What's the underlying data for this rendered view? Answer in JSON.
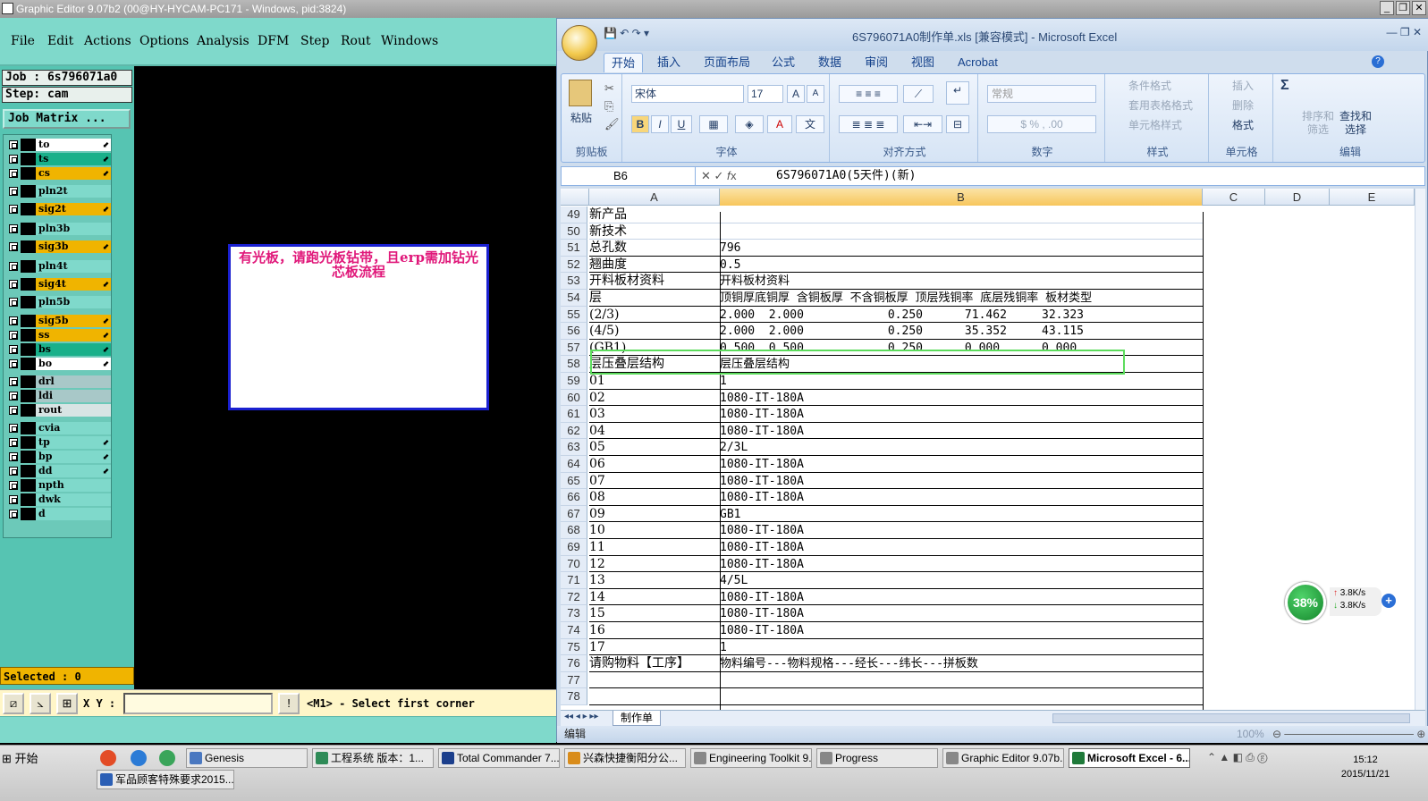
{
  "ge": {
    "title": "Graphic Editor 9.07b2 (00@HY-HYCAM-PC171 - Windows, pid:3824)",
    "menu": [
      "File",
      "Edit",
      "Actions",
      "Options",
      "Analysis",
      "DFM",
      "Step",
      "Rout",
      "Windows"
    ],
    "job_label": "Job : 6s796071a0",
    "step_label": "Step: cam",
    "job_matrix": "Job Matrix ...",
    "layers": [
      {
        "name": "to",
        "color": "#ffffff",
        "arrow": true
      },
      {
        "name": "ts",
        "color": "#19b08a",
        "arrow": true
      },
      {
        "name": "cs",
        "color": "#f0b400",
        "arrow": true
      },
      {
        "name": "pln2t",
        "color": "#7fd9cb",
        "arrow": false
      },
      {
        "name": "sig2t",
        "color": "#f0b400",
        "arrow": true
      },
      {
        "name": "pln3b",
        "color": "#7fd9cb",
        "arrow": false
      },
      {
        "name": "sig3b",
        "color": "#f0b400",
        "arrow": true
      },
      {
        "name": "pln4t",
        "color": "#7fd9cb",
        "arrow": false
      },
      {
        "name": "sig4t",
        "color": "#f0b400",
        "arrow": true
      },
      {
        "name": "pln5b",
        "color": "#7fd9cb",
        "arrow": false
      },
      {
        "name": "sig5b",
        "color": "#f0b400",
        "arrow": true
      },
      {
        "name": "ss",
        "color": "#f0b400",
        "arrow": true
      },
      {
        "name": "bs",
        "color": "#19b08a",
        "arrow": true
      },
      {
        "name": "bo",
        "color": "#ffffff",
        "arrow": true
      },
      {
        "name": "drl",
        "color": "#a8c8c8",
        "arrow": false
      },
      {
        "name": "ldi",
        "color": "#a8c8c8",
        "arrow": false
      },
      {
        "name": "rout",
        "color": "#d8e4e4",
        "arrow": false
      },
      {
        "name": "cvia",
        "color": "#7fd9cb",
        "arrow": false
      },
      {
        "name": "tp",
        "color": "#7fd9cb",
        "arrow": true
      },
      {
        "name": "bp",
        "color": "#7fd9cb",
        "arrow": true
      },
      {
        "name": "dd",
        "color": "#7fd9cb",
        "arrow": true
      },
      {
        "name": "npth",
        "color": "#7fd9cb",
        "arrow": false
      },
      {
        "name": "dwk",
        "color": "#7fd9cb",
        "arrow": false
      },
      {
        "name": "d",
        "color": "#7fd9cb",
        "arrow": false
      }
    ],
    "selected": "Selected : 0",
    "note": "有光板，请跑光板钻带，且erp需加钻光芯板流程",
    "xy_label": "X Y :",
    "xy_value": "",
    "status_msg": "<M1> - Select first corner"
  },
  "excel": {
    "title": "6S796071A0制作单.xls [兼容模式] - Microsoft Excel",
    "tabs": [
      "开始",
      "插入",
      "页面布局",
      "公式",
      "数据",
      "审阅",
      "视图",
      "Acrobat"
    ],
    "groups": {
      "clipboard": "剪贴板",
      "paste": "粘贴",
      "font": "字体",
      "align": "对齐方式",
      "number": "数字",
      "styles": "样式",
      "cells": "单元格",
      "edit": "编辑",
      "font_name": "宋体",
      "font_size": "17",
      "number_format": "常规",
      "cond_format": "条件格式",
      "table_format": "套用表格格式",
      "cell_style": "单元格样式",
      "insert": "插入",
      "delete": "删除",
      "format": "格式",
      "sort_filter": "排序和\n筛选",
      "find_select": "查找和\n选择"
    },
    "name_box": "B6",
    "formula": "6S796071A0(5天件)(新)",
    "columns": [
      "A",
      "B",
      "C",
      "D",
      "E"
    ],
    "rows": [
      {
        "n": "49",
        "a": "新产品",
        "b": ""
      },
      {
        "n": "50",
        "a": "新技术",
        "b": ""
      },
      {
        "n": "51",
        "a": "总孔数",
        "b": "796"
      },
      {
        "n": "52",
        "a": "翘曲度",
        "b": "0.5"
      },
      {
        "n": "53",
        "a": "开料板材资料",
        "b": "开料板材资料"
      },
      {
        "n": "54",
        "a": "层",
        "b": "顶铜厚底铜厚 含铜板厚 不含铜板厚 顶层残铜率 底层残铜率 板材类型"
      },
      {
        "n": "55",
        "a": "(2/3)",
        "b": "2.000  2.000            0.250      71.462     32.323"
      },
      {
        "n": "56",
        "a": "(4/5)",
        "b": "2.000  2.000            0.250      35.352     43.115"
      },
      {
        "n": "57",
        "a": "(GB1)",
        "b": "0.500  0.500            0.250      0.000      0.000"
      },
      {
        "n": "58",
        "a": "层压叠层结构",
        "b": "层压叠层结构"
      },
      {
        "n": "59",
        "a": "01",
        "b": "1"
      },
      {
        "n": "60",
        "a": "02",
        "b": "1080-IT-180A"
      },
      {
        "n": "61",
        "a": "03",
        "b": "1080-IT-180A"
      },
      {
        "n": "62",
        "a": "04",
        "b": "1080-IT-180A"
      },
      {
        "n": "63",
        "a": "05",
        "b": "2/3L"
      },
      {
        "n": "64",
        "a": "06",
        "b": "1080-IT-180A"
      },
      {
        "n": "65",
        "a": "07",
        "b": "1080-IT-180A"
      },
      {
        "n": "66",
        "a": "08",
        "b": "1080-IT-180A"
      },
      {
        "n": "67",
        "a": "09",
        "b": "GB1"
      },
      {
        "n": "68",
        "a": "10",
        "b": "1080-IT-180A"
      },
      {
        "n": "69",
        "a": "11",
        "b": "1080-IT-180A"
      },
      {
        "n": "70",
        "a": "12",
        "b": "1080-IT-180A"
      },
      {
        "n": "71",
        "a": "13",
        "b": "4/5L"
      },
      {
        "n": "72",
        "a": "14",
        "b": "1080-IT-180A"
      },
      {
        "n": "73",
        "a": "15",
        "b": "1080-IT-180A"
      },
      {
        "n": "74",
        "a": "16",
        "b": "1080-IT-180A"
      },
      {
        "n": "75",
        "a": "17",
        "b": "1"
      },
      {
        "n": "76",
        "a": "请购物料【工序】",
        "b": "物料编号---物料规格---经长---纬长---拼板数"
      },
      {
        "n": "77",
        "a": "",
        "b": ""
      },
      {
        "n": "78",
        "a": "",
        "b": ""
      }
    ],
    "sheet_tab": "制作单",
    "status": "编辑",
    "zoom": "100%"
  },
  "net": {
    "percent": "38%",
    "up": "3.8K/s",
    "down": "3.8K/s"
  },
  "taskbar": {
    "start": "开始",
    "items": [
      "Genesis",
      "工程系统  版本：1...",
      "Total Commander 7....",
      "兴森快捷衡阳分公...",
      "Engineering Toolkit 9...",
      "Progress",
      "Graphic Editor 9.07b...",
      "Microsoft Excel - 6...",
      "军品顾客特殊要求2015..."
    ],
    "time": "15:12",
    "date": "2015/11/21"
  }
}
